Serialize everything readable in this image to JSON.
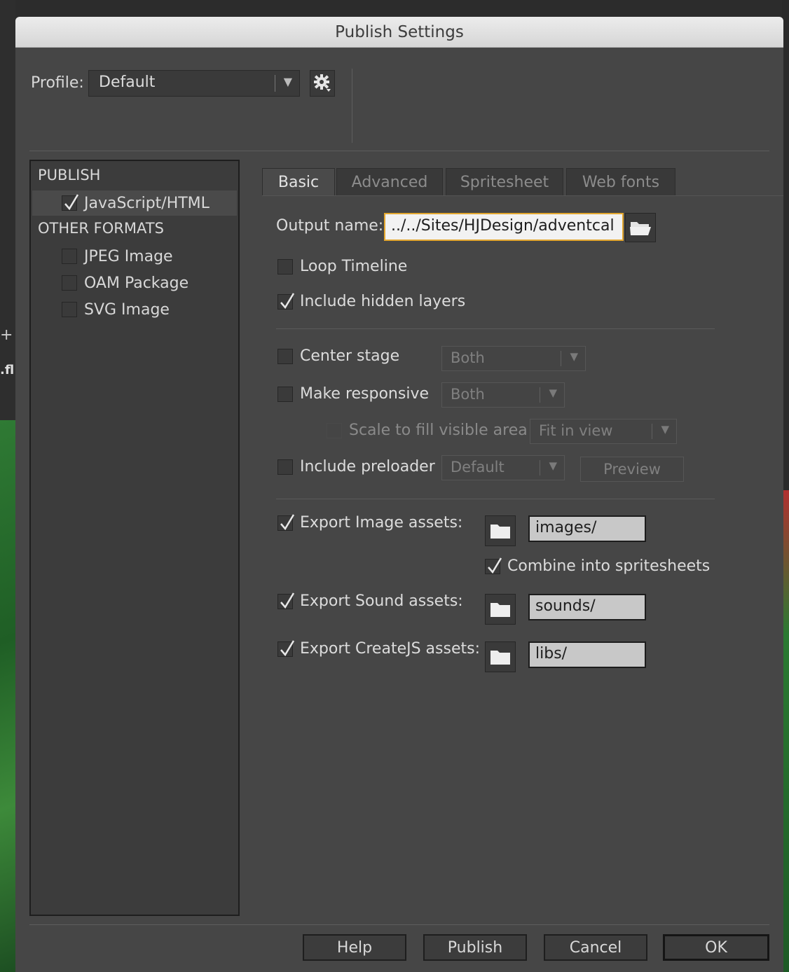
{
  "window": {
    "title": "Publish Settings"
  },
  "backdrop": {
    "edge_text": ".fl",
    "edge_plus": "+"
  },
  "profile": {
    "label": "Profile:",
    "value": "Default",
    "gear_icon": "gear-icon"
  },
  "sidebar": {
    "publish_heading": "PUBLISH",
    "publish_items": [
      {
        "label": "JavaScript/HTML",
        "checked": true,
        "selected": true
      }
    ],
    "other_heading": "OTHER FORMATS",
    "other_items": [
      {
        "label": "JPEG Image",
        "checked": false
      },
      {
        "label": "OAM Package",
        "checked": false
      },
      {
        "label": "SVG Image",
        "checked": false
      }
    ]
  },
  "tabs": [
    {
      "label": "Basic",
      "active": true
    },
    {
      "label": "Advanced",
      "active": false
    },
    {
      "label": "Spritesheet",
      "active": false
    },
    {
      "label": "Web fonts",
      "active": false
    }
  ],
  "basic": {
    "output_label": "Output name:",
    "output_value": "../../Sites/HJDesign/adventcal",
    "loop_timeline": {
      "label": "Loop Timeline",
      "checked": false
    },
    "include_hidden": {
      "label": "Include hidden layers",
      "checked": true
    },
    "center_stage": {
      "label": "Center stage",
      "checked": false,
      "option": "Both"
    },
    "make_responsive": {
      "label": "Make responsive",
      "checked": false,
      "option": "Both"
    },
    "scale_fill": {
      "label": "Scale to fill visible area",
      "checked": false,
      "option": "Fit in view"
    },
    "include_preloader": {
      "label": "Include preloader",
      "checked": false,
      "option": "Default",
      "preview_label": "Preview"
    },
    "export_image": {
      "label": "Export Image assets:",
      "checked": true,
      "path": "images/"
    },
    "combine_sprites": {
      "label": "Combine into spritesheets",
      "checked": true
    },
    "export_sound": {
      "label": "Export Sound assets:",
      "checked": true,
      "path": "sounds/"
    },
    "export_createjs": {
      "label": "Export CreateJS assets:",
      "checked": true,
      "path": "libs/"
    }
  },
  "footer": {
    "help": "Help",
    "publish": "Publish",
    "cancel": "Cancel",
    "ok": "OK"
  }
}
